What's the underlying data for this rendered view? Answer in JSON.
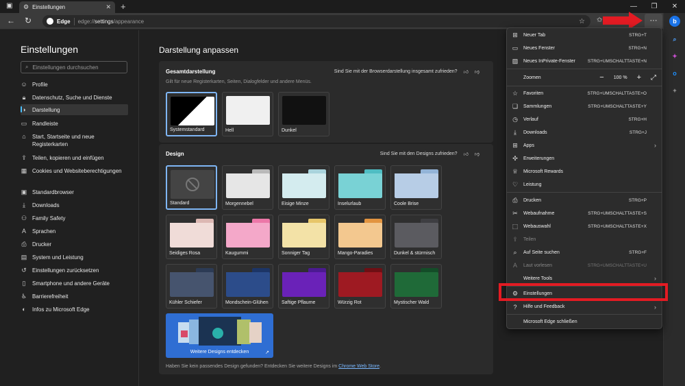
{
  "tab": {
    "title": "Einstellungen"
  },
  "address": {
    "site": "Edge",
    "url_prefix": "edge://",
    "url_main": "settings",
    "url_suffix": "/appearance"
  },
  "sidebar": {
    "title": "Einstellungen",
    "search_placeholder": "Einstellungen durchsuchen",
    "items": [
      {
        "label": "Profile",
        "icon": "person-icon"
      },
      {
        "label": "Datenschutz, Suche und Dienste",
        "icon": "lock-icon"
      },
      {
        "label": "Darstellung",
        "icon": "palette-icon"
      },
      {
        "label": "Randleiste",
        "icon": "sidebar-icon"
      },
      {
        "label": "Start, Startseite und neue Registerkarten",
        "icon": "home-icon"
      },
      {
        "label": "Teilen, kopieren und einfügen",
        "icon": "share-icon"
      },
      {
        "label": "Cookies und Websiteberechtigungen",
        "icon": "cookie-icon"
      },
      {
        "label": "Standardbrowser",
        "icon": "browser-icon"
      },
      {
        "label": "Downloads",
        "icon": "download-icon"
      },
      {
        "label": "Family Safety",
        "icon": "family-icon"
      },
      {
        "label": "Sprachen",
        "icon": "language-icon"
      },
      {
        "label": "Drucker",
        "icon": "printer-icon"
      },
      {
        "label": "System und Leistung",
        "icon": "system-icon"
      },
      {
        "label": "Einstellungen zurücksetzen",
        "icon": "reset-icon"
      },
      {
        "label": "Smartphone und andere Geräte",
        "icon": "phone-icon"
      },
      {
        "label": "Barrierefreiheit",
        "icon": "accessibility-icon"
      },
      {
        "label": "Infos zu Microsoft Edge",
        "icon": "edge-icon"
      }
    ]
  },
  "main": {
    "title": "Darstellung anpassen",
    "overall": {
      "title": "Gesamtdarstellung",
      "subtitle": "Gilt für neue Registerkarten, Seiten, Dialogfelder und andere Menüs.",
      "feedback": "Sind Sie mit der Browserdarstellung insgesamt zufrieden?",
      "options": [
        "Systemstandard",
        "Hell",
        "Dunkel"
      ]
    },
    "design": {
      "title": "Design",
      "feedback": "Sind Sie mit den Designs zufrieden?",
      "themes": [
        {
          "name": "Standard",
          "tab": "#555555",
          "body": "#444444"
        },
        {
          "name": "Morgennebel",
          "tab": "#b9b9b9",
          "body": "#e6e6e6"
        },
        {
          "name": "Eisige Minze",
          "tab": "#a9d3dc",
          "body": "#d4ecef"
        },
        {
          "name": "Inselurlaub",
          "tab": "#4fbdc3",
          "body": "#79d2d5"
        },
        {
          "name": "Coole Brise",
          "tab": "#93b4d8",
          "body": "#b7cde6"
        },
        {
          "name": "Seidiges Rosa",
          "tab": "#dcb8b3",
          "body": "#f0dcd8"
        },
        {
          "name": "Kaugummi",
          "tab": "#ec77a8",
          "body": "#f4a8c9"
        },
        {
          "name": "Sonniger Tag",
          "tab": "#e7c66a",
          "body": "#f3e2a7"
        },
        {
          "name": "Mango-Paradies",
          "tab": "#e29440",
          "body": "#f3c88f"
        },
        {
          "name": "Dunkel & stürmisch",
          "tab": "#3e3e42",
          "body": "#5b5b60"
        },
        {
          "name": "Kühler Schiefer",
          "tab": "#2c3b55",
          "body": "#46546e"
        },
        {
          "name": "Mondschein-Glühen",
          "tab": "#1c3566",
          "body": "#2c4c8a"
        },
        {
          "name": "Saftige Pflaume",
          "tab": "#4b1a91",
          "body": "#6a22b8"
        },
        {
          "name": "Würzig Rot",
          "tab": "#6e0f14",
          "body": "#9e1a22"
        },
        {
          "name": "Mystischer Wald",
          "tab": "#134d28",
          "body": "#1f6a38"
        }
      ],
      "discover_label": "Weitere Designs entdecken",
      "footer_text": "Haben Sie kein passendes Design gefunden? Entdecken Sie weitere Designs im",
      "footer_link": "Chrome Web Store",
      "footer_end": "."
    }
  },
  "menu": {
    "items": [
      {
        "label": "Neuer Tab",
        "shortcut": "STRG+T",
        "icon": "new-tab-icon"
      },
      {
        "label": "Neues Fenster",
        "shortcut": "STRG+N",
        "icon": "new-window-icon"
      },
      {
        "label": "Neues InPrivate-Fenster",
        "shortcut": "STRG+UMSCHALTTASTE+N",
        "icon": "inprivate-icon"
      }
    ],
    "zoom": {
      "label": "Zoomen",
      "value": "100 %"
    },
    "items2": [
      {
        "label": "Favoriten",
        "shortcut": "STRG+UMSCHALTTASTE+O",
        "icon": "favorites-icon"
      },
      {
        "label": "Sammlungen",
        "shortcut": "STRG+UMSCHALTTASTE+Y",
        "icon": "collections-icon"
      },
      {
        "label": "Verlauf",
        "shortcut": "STRG+H",
        "icon": "history-icon"
      },
      {
        "label": "Downloads",
        "shortcut": "STRG+J",
        "icon": "download-icon"
      },
      {
        "label": "Apps",
        "shortcut": "",
        "icon": "apps-icon",
        "arrow": true
      },
      {
        "label": "Erweiterungen",
        "shortcut": "",
        "icon": "extensions-icon"
      },
      {
        "label": "Microsoft Rewards",
        "shortcut": "",
        "icon": "rewards-icon"
      },
      {
        "label": "Leistung",
        "shortcut": "",
        "icon": "performance-icon"
      }
    ],
    "items3": [
      {
        "label": "Drucken",
        "shortcut": "STRG+P",
        "icon": "printer-icon"
      },
      {
        "label": "Webaufnahme",
        "shortcut": "STRG+UMSCHALTTASTE+S",
        "icon": "capture-icon"
      },
      {
        "label": "Webauswahl",
        "shortcut": "STRG+UMSCHALTTASTE+X",
        "icon": "web-select-icon"
      },
      {
        "label": "Teilen",
        "shortcut": "",
        "icon": "share-icon",
        "disabled": true
      },
      {
        "label": "Auf Seite suchen",
        "shortcut": "STRG+F",
        "icon": "find-icon"
      },
      {
        "label": "Laut vorlesen",
        "shortcut": "STRG+UMSCHALTTASTE+U",
        "icon": "read-aloud-icon",
        "disabled": true
      },
      {
        "label": "Weitere Tools",
        "shortcut": "",
        "icon": "",
        "arrow": true
      }
    ],
    "items4": [
      {
        "label": "Einstellungen",
        "shortcut": "",
        "icon": "gear-icon"
      },
      {
        "label": "Hilfe und Feedback",
        "shortcut": "",
        "icon": "help-icon",
        "arrow": true
      }
    ],
    "close": {
      "label": "Microsoft Edge schließen"
    }
  },
  "colors": {
    "accent": "#4cc2ff",
    "highlight": "#e31b23",
    "menu_bg": "#2c2c2c"
  }
}
